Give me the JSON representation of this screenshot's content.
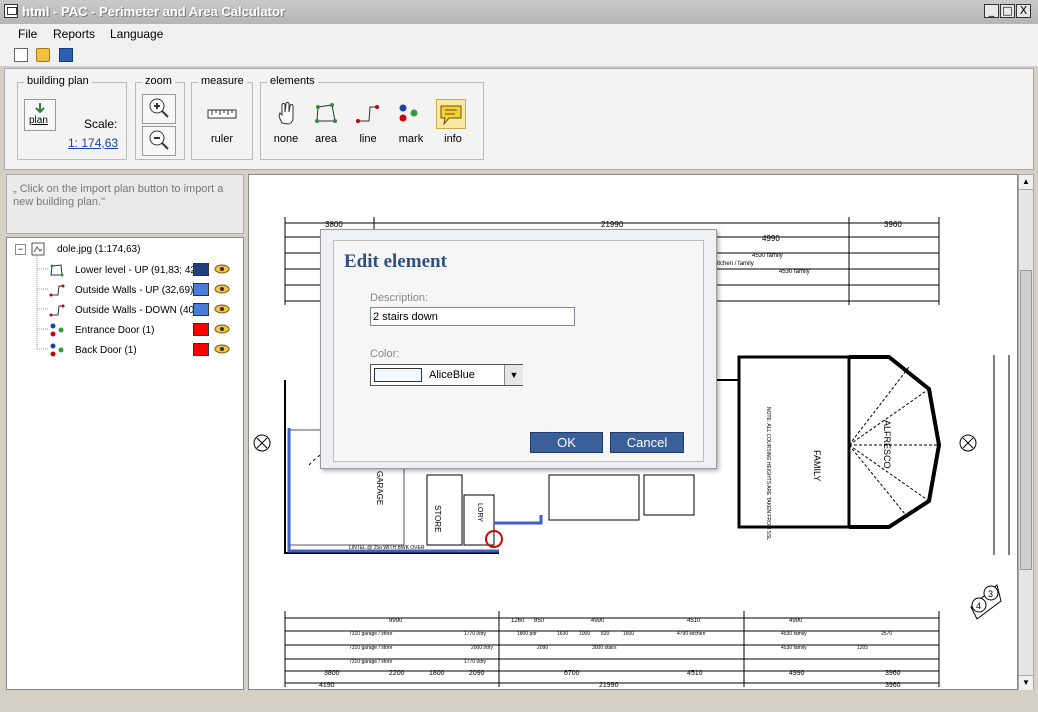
{
  "window": {
    "title": "html - PAC - Perimeter and Area Calculator",
    "minimize_glyph": "_",
    "maximize_glyph": "□",
    "close_glyph": "X"
  },
  "menu": {
    "file": "File",
    "reports": "Reports",
    "language": "Language"
  },
  "ribbon": {
    "building_plan": {
      "label": "building plan",
      "button": "plan",
      "scale_label": "Scale:",
      "scale_value": "1: 174,63"
    },
    "zoom": {
      "label": "zoom"
    },
    "measure": {
      "label": "measure",
      "ruler": "ruler"
    },
    "elements": {
      "label": "elements",
      "none": "none",
      "area": "area",
      "line": "line",
      "mark": "mark",
      "info": "info"
    }
  },
  "left_panel": {
    "hint": "„ Click on the import plan button to import a new building plan.\"",
    "tree": {
      "root": {
        "expander": "−",
        "label": "dole.jpg (1:174,63)"
      },
      "items": [
        {
          "label": "Lower level - UP (91,83; 42,",
          "color": "#1f3f7f"
        },
        {
          "label": "Outside Walls - UP (32,69)",
          "color": "#4a7cd8"
        },
        {
          "label": "Outside Walls - DOWN (40,",
          "color": "#4a7cd8"
        },
        {
          "label": "Entrance Door (1)",
          "color": "#ff0000"
        },
        {
          "label": "Back Door (1)",
          "color": "#ff0000"
        }
      ]
    }
  },
  "dialog": {
    "title": "Edit element",
    "description_label": "Description:",
    "description_value": "2 stairs down",
    "color_label": "Color:",
    "color_value": "AliceBlue",
    "ok": "OK",
    "cancel": "Cancel"
  },
  "plan": {
    "top_dims": [
      "3800",
      "21990",
      "4990",
      "3960"
    ],
    "top_row2": [
      "4530 family",
      "8830 kitchen / family",
      "4530 family"
    ],
    "rooms": {
      "family": "FAMILY",
      "alfresco": "ALFRESCO",
      "store": "STORE",
      "garage": "GARAGE",
      "lory": "LORY",
      "note": "NOTE: ALL COURSING HEIGHTS ARE TAKEN FROM SSL"
    },
    "bottom_row1": [
      "9990",
      "1260",
      "850",
      "4990",
      "4510",
      "4990"
    ],
    "bottom_row2": [
      "7310 garage / store",
      "1770 l/dry",
      "1800 pdr",
      "1630",
      "1000",
      "820",
      "1600",
      "4790 kitchen",
      "4530 family",
      "2570"
    ],
    "bottom_row3": [
      "7310 garage / store",
      "2000 l/dry",
      "2090",
      "3000 stairs",
      "4530 family",
      "1205"
    ],
    "bottom_row4": [
      "7310 garage / store",
      "1770 l/dry"
    ],
    "bottom_row5": [
      "3800",
      "2200",
      "1800",
      "2090",
      "6700",
      "4510",
      "4990",
      "3960"
    ],
    "bottom_total": [
      "4190",
      "21990",
      "3960"
    ],
    "lintel": "LINTEL @ 25o WITH BWK OVER",
    "sheet_tag_a": "3",
    "sheet_tag_b": "4"
  },
  "colors": {
    "dialog_button": "#3a5f99",
    "title_text": "#ffffff",
    "selection": "#3a62c9"
  }
}
